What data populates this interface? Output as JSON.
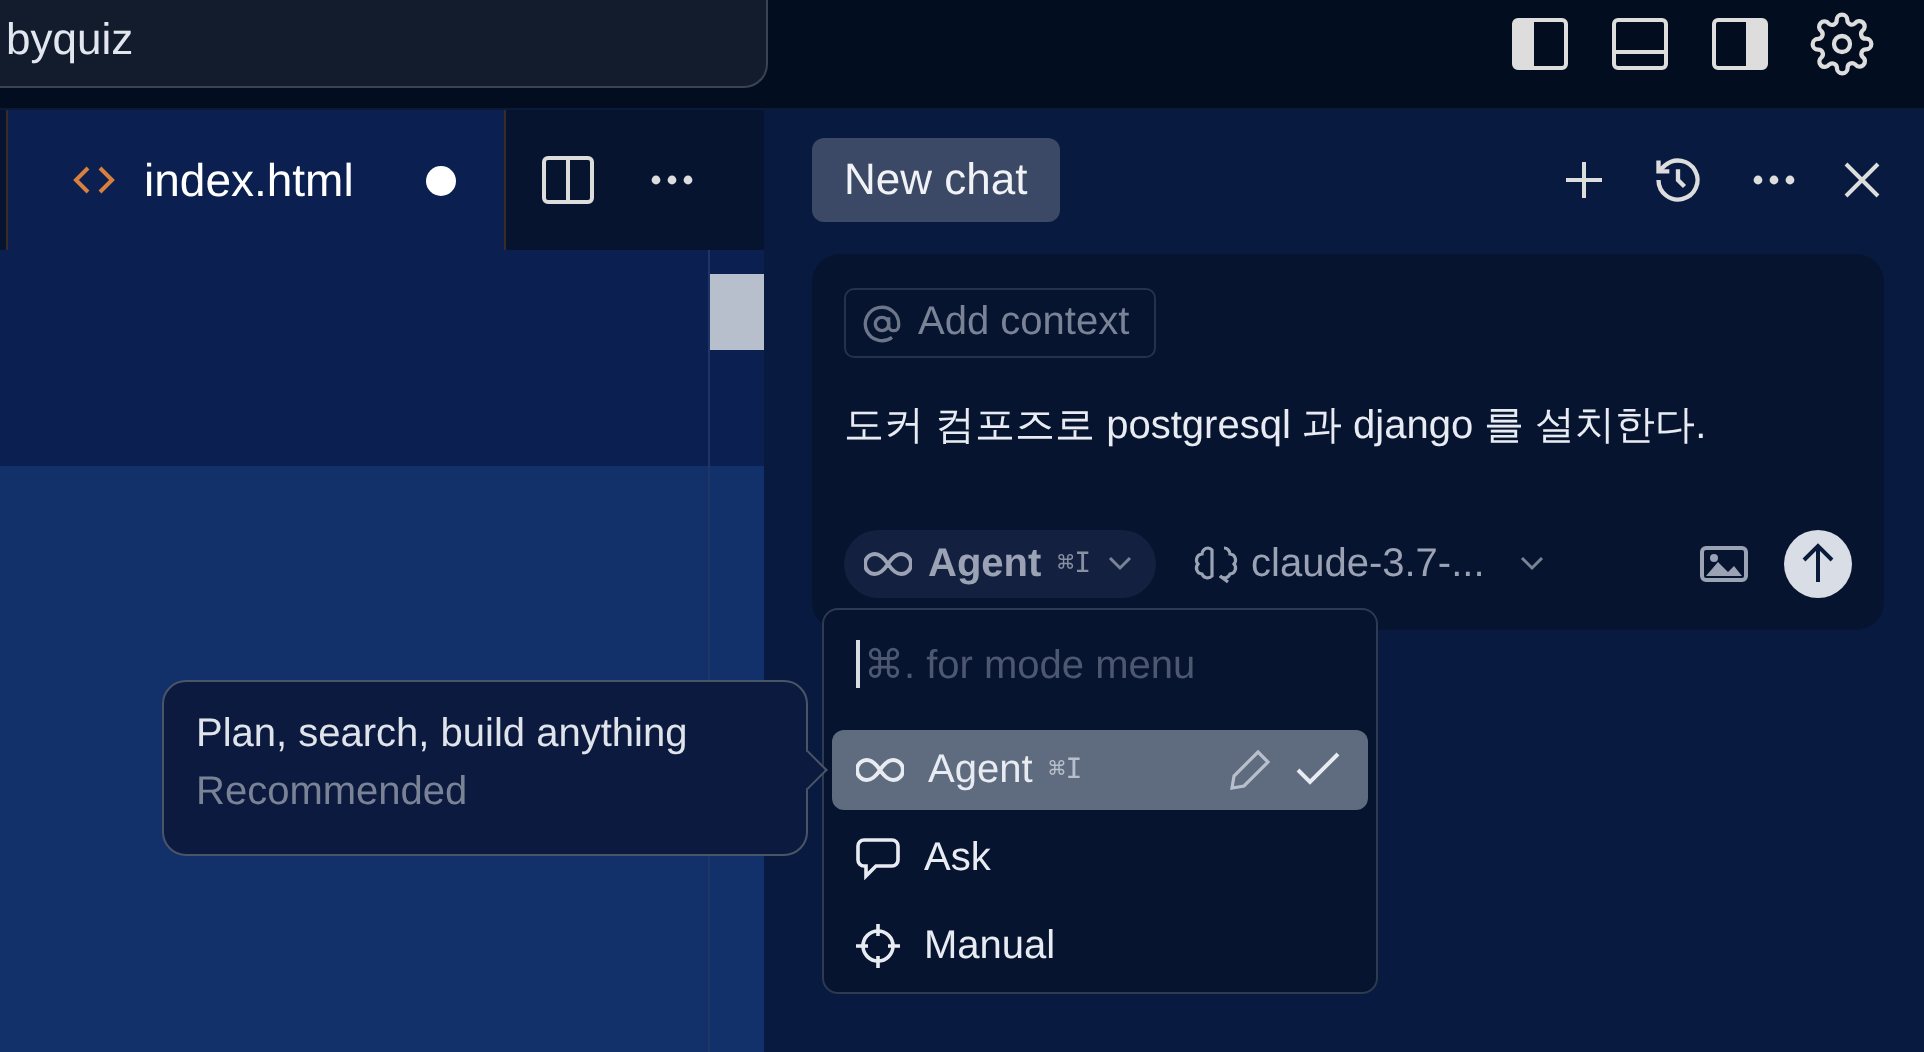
{
  "top_bar": {
    "search_value": "byquiz"
  },
  "editor": {
    "tabs": [
      {
        "label": "index.html",
        "selected": true,
        "unsaved": true
      }
    ]
  },
  "chat": {
    "title": "New chat",
    "add_context": "Add context",
    "message": "도커 컴포즈로 postgresql 과 django 를 설치한다.",
    "mode": {
      "label": "Agent",
      "shortcut": "⌘I"
    },
    "model": "claude-3.7-..."
  },
  "mode_menu": {
    "placeholder": "⌘. for mode menu",
    "items": [
      {
        "kind": "agent",
        "label": "Agent",
        "shortcut": "⌘I",
        "selected": true
      },
      {
        "kind": "ask",
        "label": "Ask",
        "selected": false
      },
      {
        "kind": "manual",
        "label": "Manual",
        "selected": false
      }
    ]
  },
  "tooltip": {
    "title": "Plan, search, build anything",
    "subtitle": "Recommended"
  }
}
